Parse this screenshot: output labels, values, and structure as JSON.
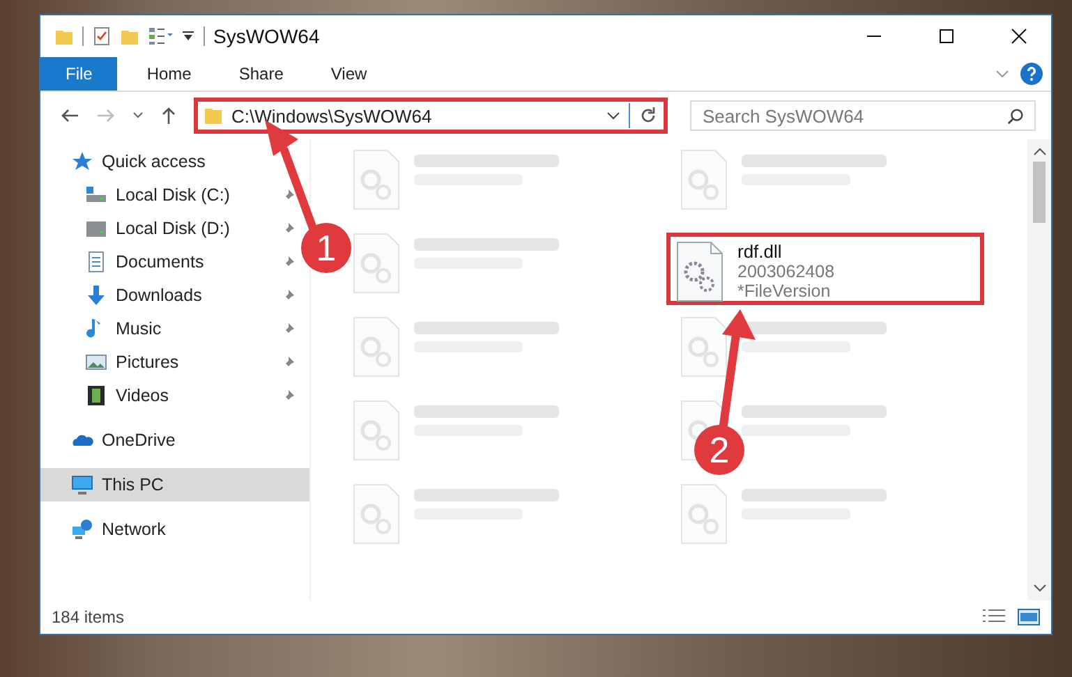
{
  "window": {
    "title": "SysWOW64"
  },
  "ribbon": {
    "tabs": [
      {
        "label": "File",
        "selected": true
      },
      {
        "label": "Home",
        "selected": false
      },
      {
        "label": "Share",
        "selected": false
      },
      {
        "label": "View",
        "selected": false
      }
    ]
  },
  "address_bar": {
    "path": "C:\\Windows\\SysWOW64",
    "highlighted": true
  },
  "search": {
    "placeholder": "Search SysWOW64"
  },
  "nav": {
    "items": [
      {
        "label": "Quick access",
        "kind": "star",
        "selected": false,
        "children": [
          {
            "label": "Local Disk (C:)",
            "kind": "disk-c",
            "selected": false,
            "pinned": true
          },
          {
            "label": "Local Disk (D:)",
            "kind": "disk",
            "selected": false,
            "pinned": true
          },
          {
            "label": "Documents",
            "kind": "documents",
            "selected": false,
            "pinned": true
          },
          {
            "label": "Downloads",
            "kind": "downloads",
            "selected": false,
            "pinned": true
          },
          {
            "label": "Music",
            "kind": "music",
            "selected": false,
            "pinned": true
          },
          {
            "label": "Pictures",
            "kind": "pictures",
            "selected": false,
            "pinned": true
          },
          {
            "label": "Videos",
            "kind": "videos",
            "selected": false,
            "pinned": true
          }
        ]
      },
      {
        "label": "OneDrive",
        "kind": "cloud",
        "selected": false
      },
      {
        "label": "This PC",
        "kind": "pc",
        "selected": true
      },
      {
        "label": "Network",
        "kind": "network",
        "selected": false
      }
    ]
  },
  "files": [
    {
      "kind": "blurred"
    },
    {
      "kind": "blurred"
    },
    {
      "kind": "blurred"
    },
    {
      "kind": "file",
      "name": "rdf.dll",
      "lines": [
        "2003062408",
        "*FileVersion"
      ],
      "highlighted": true
    },
    {
      "kind": "blurred"
    },
    {
      "kind": "blurred"
    },
    {
      "kind": "blurred"
    },
    {
      "kind": "blurred"
    },
    {
      "kind": "blurred"
    },
    {
      "kind": "blurred"
    }
  ],
  "status_bar": {
    "count": "184 items"
  },
  "annotations": [
    {
      "number": "1"
    },
    {
      "number": "2"
    }
  ]
}
